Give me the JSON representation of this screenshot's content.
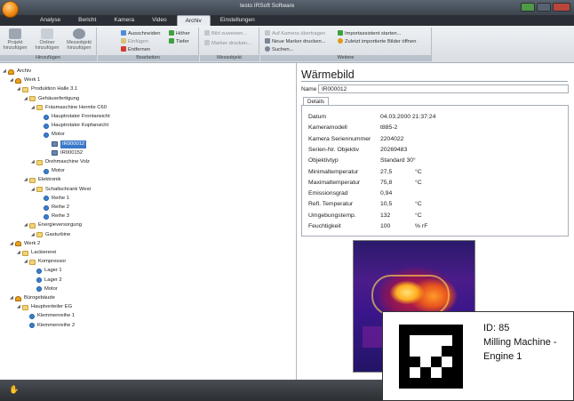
{
  "window": {
    "title": "testo IRSoft Software"
  },
  "menu": {
    "tabs": [
      "Analyse",
      "Bericht",
      "Kamera",
      "Video",
      "Archiv",
      "Einstellungen"
    ],
    "active": "Archiv"
  },
  "ribbon": {
    "groups": [
      {
        "label": "Hinzufügen",
        "buttons": [
          "Projekt hinzufügen",
          "Ordner hinzufügen",
          "Messobjekt hinzufügen"
        ]
      },
      {
        "label": "Bearbeiten",
        "buttons": [
          "Ausschneiden",
          "Einfügen",
          "Entfernen",
          "Höher",
          "Tiefer"
        ]
      },
      {
        "label": "Messobjekt",
        "buttons": [
          "Bild zuweisen...",
          "Marker drucken..."
        ]
      },
      {
        "label": "Weitere",
        "buttons": [
          "Auf Kamera übertragen",
          "Neue Marker drucken...",
          "Suchen...",
          "Importassistent starten...",
          "Zuletzt importierte Bilder öffnen"
        ]
      }
    ]
  },
  "tree": [
    {
      "label": "Archiv",
      "level": 0,
      "icon": "archive-icon"
    },
    {
      "label": "Werk 1",
      "level": 1,
      "icon": "building-icon"
    },
    {
      "label": "Produktion Halle 3.1",
      "level": 2,
      "icon": "folder-icon"
    },
    {
      "label": "Gehäusefertigung",
      "level": 3,
      "icon": "folder-icon"
    },
    {
      "label": "Fräsmaschine Hermle C60",
      "level": 4,
      "icon": "folder-icon"
    },
    {
      "label": "Hauptrotator Frontansicht",
      "level": 5,
      "icon": "asset-icon"
    },
    {
      "label": "Hauptrotator Kopfansicht",
      "level": 5,
      "icon": "asset-icon"
    },
    {
      "label": "Motor",
      "level": 5,
      "icon": "asset-icon"
    },
    {
      "label": "IR000012",
      "level": 6,
      "icon": "image-icon",
      "selected": true
    },
    {
      "label": "IR000152",
      "level": 6,
      "icon": "image-icon"
    },
    {
      "label": "Drehmaschine Volz",
      "level": 4,
      "icon": "folder-icon"
    },
    {
      "label": "Motor",
      "level": 5,
      "icon": "asset-icon"
    },
    {
      "label": "Elektronik",
      "level": 3,
      "icon": "folder-icon"
    },
    {
      "label": "Schaltschrank West",
      "level": 4,
      "icon": "folder-icon"
    },
    {
      "label": "Reihe 1",
      "level": 5,
      "icon": "asset-icon"
    },
    {
      "label": "Reihe 2",
      "level": 5,
      "icon": "asset-icon"
    },
    {
      "label": "Reihe 3",
      "level": 5,
      "icon": "asset-icon"
    },
    {
      "label": "Energieversorgung",
      "level": 3,
      "icon": "folder-icon"
    },
    {
      "label": "Gasturbine",
      "level": 4,
      "icon": "folder-icon"
    },
    {
      "label": "Werk 2",
      "level": 1,
      "icon": "building-icon"
    },
    {
      "label": "Lackiererei",
      "level": 2,
      "icon": "folder-icon"
    },
    {
      "label": "Kompressor",
      "level": 3,
      "icon": "folder-icon"
    },
    {
      "label": "Lager 1",
      "level": 4,
      "icon": "asset-icon"
    },
    {
      "label": "Lager 2",
      "level": 4,
      "icon": "asset-icon"
    },
    {
      "label": "Motor",
      "level": 4,
      "icon": "asset-icon"
    },
    {
      "label": "Bürogebäude",
      "level": 1,
      "icon": "building-icon"
    },
    {
      "label": "Hauptverteiler EG",
      "level": 2,
      "icon": "folder-icon"
    },
    {
      "label": "Klemmenreihe 1",
      "level": 3,
      "icon": "asset-icon"
    },
    {
      "label": "Klemmenreihe 2",
      "level": 3,
      "icon": "asset-icon"
    }
  ],
  "detail": {
    "title": "Wärmebild",
    "name_label": "Name",
    "name_value": "IR000012",
    "tab": "Details",
    "properties": [
      {
        "label": "Datum",
        "value": "04.03.2000 21:37:24",
        "unit": ""
      },
      {
        "label": "Kameramodell",
        "value": "t885-2",
        "unit": ""
      },
      {
        "label": "Kamera Seriennummer",
        "value": "2204022",
        "unit": ""
      },
      {
        "label": "Serien-Nr. Objektiv",
        "value": "20269483",
        "unit": ""
      },
      {
        "label": "Objektivtyp",
        "value": "Standard 30°",
        "unit": ""
      },
      {
        "label": "Minimaltemperatur",
        "value": "27,5",
        "unit": "°C"
      },
      {
        "label": "Maximaltemperatur",
        "value": "75,8",
        "unit": "°C"
      },
      {
        "label": "Emissionsgrad",
        "value": "0,94",
        "unit": ""
      },
      {
        "label": "Refl. Temperatur",
        "value": "10,5",
        "unit": "°C"
      },
      {
        "label": "Umgebungstemp.",
        "value": "132",
        "unit": "°C"
      },
      {
        "label": "Feuchtigkeit",
        "value": "100",
        "unit": "% rF"
      }
    ]
  },
  "marker": {
    "text": "ID: 85\nMilling Machine -\nEngine 1"
  }
}
